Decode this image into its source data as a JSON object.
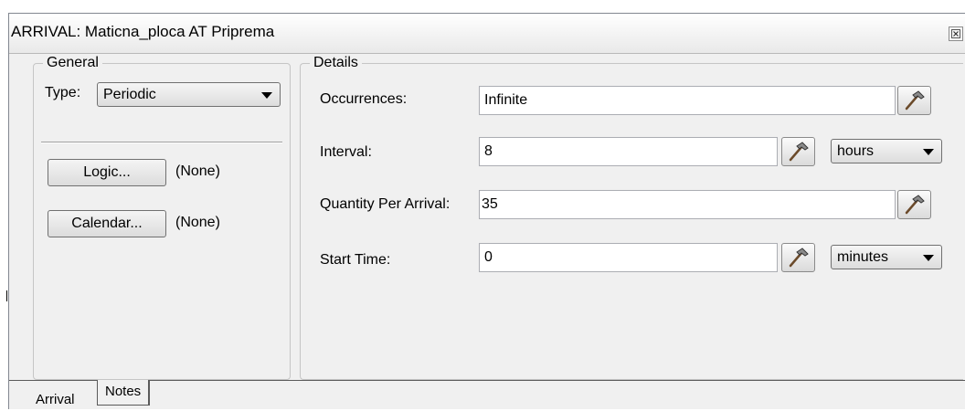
{
  "window": {
    "title": "ARRIVAL: Maticna_ploca AT Priprema",
    "close_icon": "close-icon"
  },
  "general": {
    "legend": "General",
    "type_label": "Type:",
    "type_value": "Periodic",
    "logic_button": "Logic...",
    "logic_value": "(None)",
    "calendar_button": "Calendar...",
    "calendar_value": "(None)"
  },
  "details": {
    "legend": "Details",
    "occurrences_label": "Occurrences:",
    "occurrences_value": "Infinite",
    "interval_label": "Interval:",
    "interval_value": "8",
    "interval_unit": "hours",
    "quantity_label": "Quantity Per Arrival:",
    "quantity_value": "35",
    "start_time_label": "Start Time:",
    "start_time_value": "0",
    "start_time_unit": "minutes",
    "builder_icon": "hammer-icon"
  },
  "tabs": [
    {
      "label": "Arrival",
      "active": true
    },
    {
      "label": "Notes",
      "active": false
    }
  ]
}
